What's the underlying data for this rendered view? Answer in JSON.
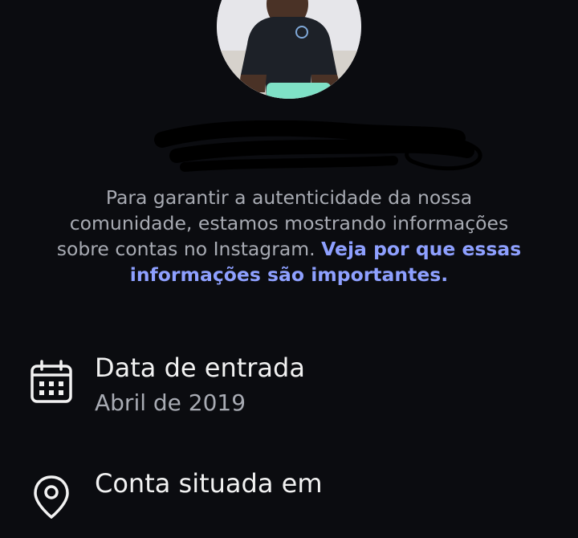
{
  "profile": {
    "avatar_icon": "profile-photo",
    "username_redacted": true
  },
  "intro": {
    "text": "Para garantir a autenticidade da nossa comunidade, estamos mostrando informações sobre contas no Instagram.",
    "link": "Veja por que essas informações são importantes."
  },
  "rows": {
    "join": {
      "icon": "calendar-icon",
      "title": "Data de entrada",
      "value": "Abril de 2019"
    },
    "location": {
      "icon": "location-pin-icon",
      "title": "Conta situada em"
    }
  },
  "colors": {
    "background": "#0b0c10",
    "primary_text": "#f2f2f2",
    "secondary_text": "#a8abb3",
    "link": "#8ea0ff"
  }
}
